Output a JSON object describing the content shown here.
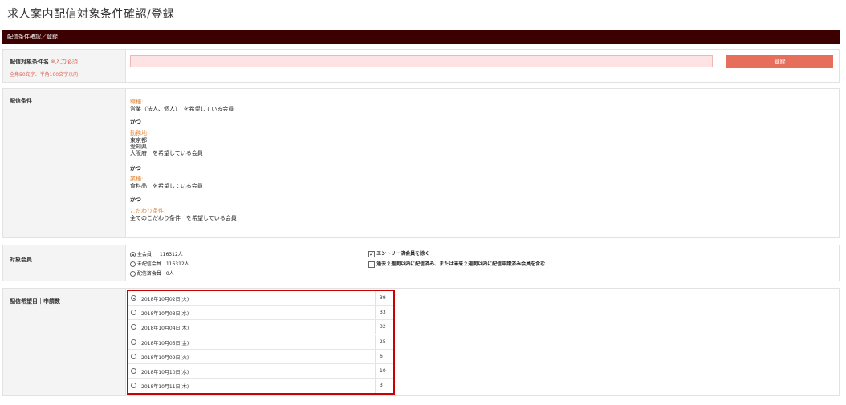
{
  "page_title": "求人案内配信対象条件確認/登録",
  "section_header": "配信条件確認／登録",
  "name_row": {
    "label": "配信対象条件名",
    "required": "※入力必須",
    "hint": "全角50文字、半角100文字以内",
    "input_value": "",
    "register_label": "登録"
  },
  "conditions_row": {
    "label": "配信条件",
    "blocks": [
      {
        "title": "職種:",
        "lines": [
          "営業（法人、個人）　を希望している会員"
        ]
      },
      {
        "title": "勤務地:",
        "lines": [
          "東京都",
          "愛知県",
          "大阪府　を希望している会員"
        ]
      },
      {
        "title": "業種:",
        "lines": [
          "食料品　を希望している会員"
        ]
      },
      {
        "title": "こだわり条件:",
        "lines": [
          "全てのこだわり条件　を希望している会員"
        ]
      }
    ],
    "connector": "かつ"
  },
  "members_row": {
    "label": "対象会員",
    "options": [
      {
        "label": "全会員",
        "count": "116312人",
        "selected": true
      },
      {
        "label": "未配信会員",
        "count": "116312人",
        "selected": false
      },
      {
        "label": "配信済会員",
        "count": "0人",
        "selected": false
      }
    ],
    "checks": [
      {
        "label": "エントリー済会員を除く",
        "checked": true
      },
      {
        "label": "過去２週間以内に配信済み、または未来２週間以内に配信申請済み会員を含む",
        "checked": false
      }
    ]
  },
  "dates_row": {
    "label": "配信希望日｜申請数",
    "dates": [
      {
        "date": "2018年10月02日(火)",
        "count": "39",
        "selected": true
      },
      {
        "date": "2018年10月03日(水)",
        "count": "33",
        "selected": false
      },
      {
        "date": "2018年10月04日(木)",
        "count": "32",
        "selected": false
      },
      {
        "date": "2018年10月05日(金)",
        "count": "25",
        "selected": false
      },
      {
        "date": "2018年10月09日(火)",
        "count": "6",
        "selected": false
      },
      {
        "date": "2018年10月10日(水)",
        "count": "10",
        "selected": false
      },
      {
        "date": "2018年10月11日(木)",
        "count": "3",
        "selected": false
      }
    ]
  }
}
